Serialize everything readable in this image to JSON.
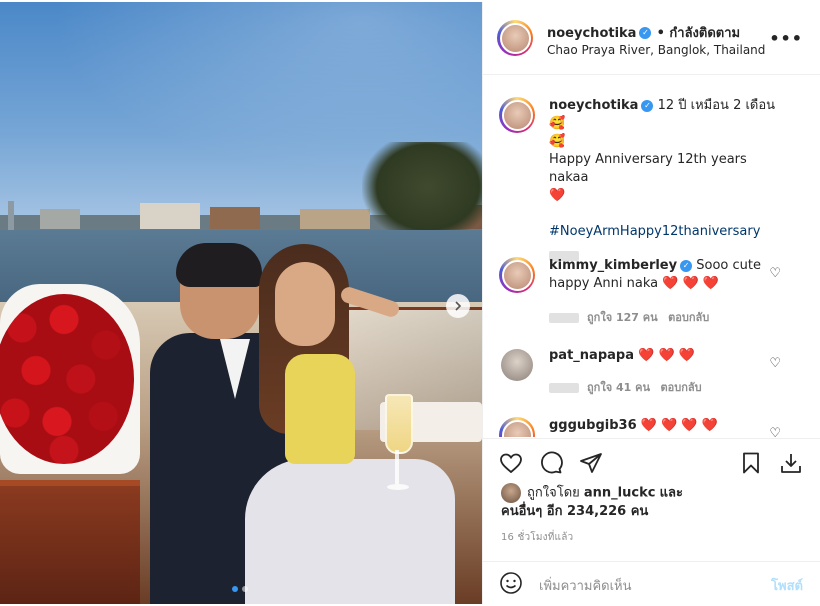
{
  "post": {
    "username": "noeychotika",
    "follow_label": "• กำลังติดตาม",
    "location": "Chao Praya River, Banglok, Thailand",
    "more_label": "•••"
  },
  "caption": {
    "username": "noeychotika",
    "line1": "12 ปี เหมือน 2 เดือน 🥰",
    "line2": "🥰",
    "line3": "Happy Anniversary 12th years nakaa",
    "line4": "❤️",
    "hashtag": "#NoeyArmHappy12thaniversary"
  },
  "comments": [
    {
      "username": "kimmy_kimberley",
      "verified": true,
      "text": "Sooo cute",
      "text2": "happy Anni naka",
      "hearts": "❤️ ❤️ ❤️",
      "likes": "ถูกใจ 127 คน",
      "reply": "ตอบกลับ"
    },
    {
      "username": "pat_napapa",
      "verified": false,
      "text": "",
      "hearts": "❤️ ❤️ ❤️",
      "likes": "ถูกใจ 41 คน",
      "reply": "ตอบกลับ"
    },
    {
      "username": "gggubgib36",
      "verified": false,
      "text": "",
      "hearts": "❤️ ❤️ ❤️ ❤️"
    }
  ],
  "liked_by": {
    "prefix": "ถูกใจโดย",
    "user": "ann_luckc",
    "and": "และ",
    "others": "คนอื่นๆ อีก 234,226 คน"
  },
  "time_ago": "16 ชั่วโมงที่แล้ว",
  "add_comment": {
    "placeholder": "เพิ่มความคิดเห็น",
    "post_label": "โพสต์"
  },
  "icons": [
    "heart-icon",
    "comment-icon",
    "share-icon",
    "save-icon",
    "download-icon",
    "emoji-icon",
    "chevron-right-icon",
    "more-icon",
    "verified-icon"
  ],
  "colors": {
    "accent": "#3897f0",
    "heart": "#ed1c2e",
    "hashtag": "#00376b",
    "post_disabled": "#b2dffc"
  }
}
